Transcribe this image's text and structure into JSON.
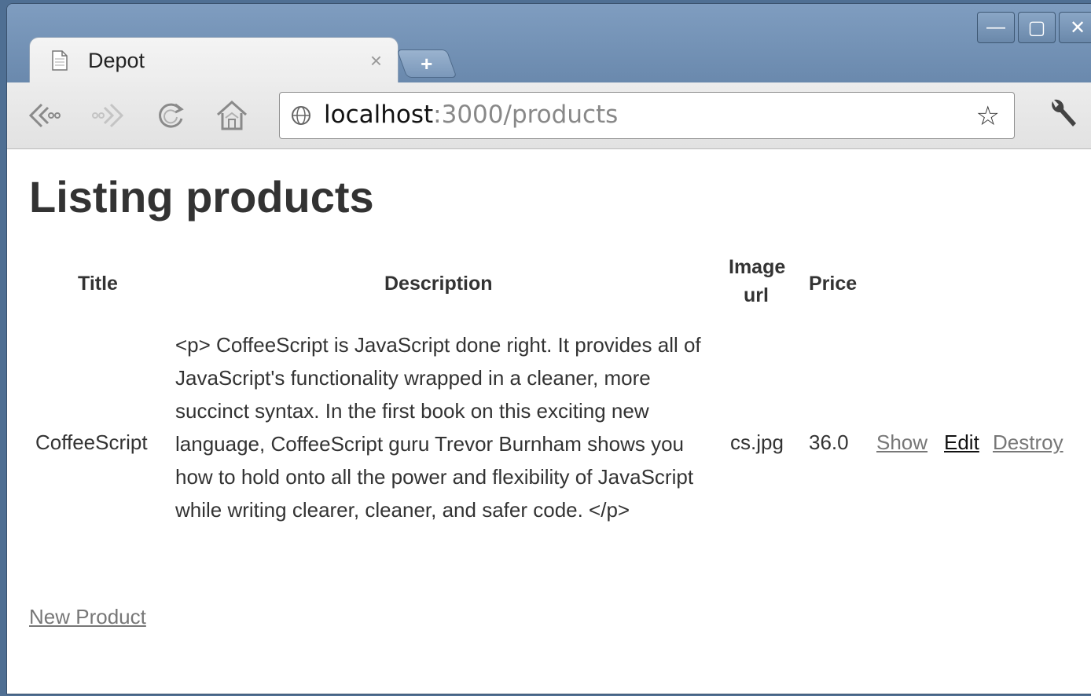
{
  "browser": {
    "tab_title": "Depot",
    "tab_close": "×",
    "new_tab": "+",
    "url_host": "localhost",
    "url_path": ":3000/products",
    "window_controls": {
      "minimize": "—",
      "maximize": "▢",
      "close": "✕"
    },
    "nav_icons": {
      "back": "back-icon",
      "forward": "forward-icon",
      "reload": "reload-icon",
      "home": "home-icon",
      "bookmark": "star-icon",
      "menu": "wrench-icon"
    }
  },
  "page": {
    "heading": "Listing products",
    "table": {
      "headers": {
        "title": "Title",
        "description": "Description",
        "image_url_line1": "Image",
        "image_url_line2": "url",
        "price": "Price"
      },
      "rows": [
        {
          "title": "CoffeeScript",
          "description": "<p> CoffeeScript is JavaScript done right. It provides all of JavaScript's functionality wrapped in a cleaner, more succinct syntax. In the first book on this exciting new language, CoffeeScript guru Trevor Burnham shows you how to hold onto all the power and flexibility of JavaScript while writing clearer, cleaner, and safer code. </p>",
          "image_url": "cs.jpg",
          "price": "36.0",
          "actions": {
            "show": "Show",
            "edit": "Edit",
            "destroy": "Destroy"
          }
        }
      ]
    },
    "new_product_link": "New Product"
  }
}
